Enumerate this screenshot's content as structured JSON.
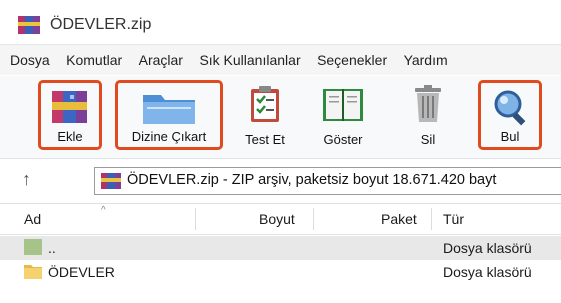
{
  "window": {
    "title": "ÖDEVLER.zip"
  },
  "menu": [
    "Dosya",
    "Komutlar",
    "Araçlar",
    "Sık Kullanılanlar",
    "Seçenekler",
    "Yardım"
  ],
  "toolbar": {
    "add": "Ekle",
    "extract": "Dizine Çıkart",
    "test": "Test Et",
    "view": "Göster",
    "delete": "Sil",
    "find": "Bul"
  },
  "address": {
    "path": "ÖDEVLER.zip - ZIP arşiv, paketsiz boyut 18.671.420 bayt"
  },
  "columns": {
    "name": "Ad",
    "size": "Boyut",
    "packed": "Paket",
    "type": "Tür"
  },
  "rows": [
    {
      "name": "..",
      "type": "Dosya klasörü",
      "icon": "parent-folder-icon"
    },
    {
      "name": "ÖDEVLER",
      "type": "Dosya klasörü",
      "icon": "folder-icon"
    }
  ],
  "colors": {
    "highlight": "#e04a1f",
    "folder": "#f6d26e",
    "parent_folder": "#a6c48a"
  }
}
